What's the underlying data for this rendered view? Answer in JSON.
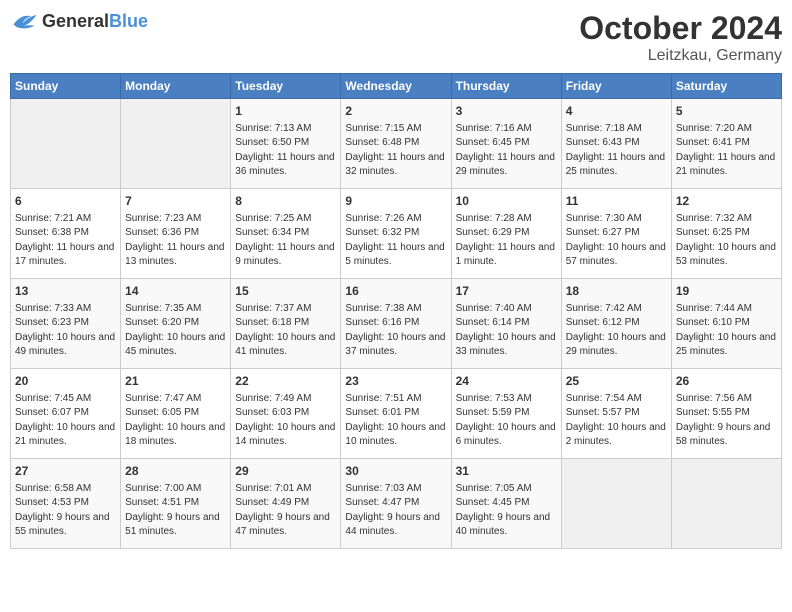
{
  "header": {
    "logo_general": "General",
    "logo_blue": "Blue",
    "month_year": "October 2024",
    "location": "Leitzkau, Germany"
  },
  "weekdays": [
    "Sunday",
    "Monday",
    "Tuesday",
    "Wednesday",
    "Thursday",
    "Friday",
    "Saturday"
  ],
  "weeks": [
    [
      {
        "day": "",
        "info": ""
      },
      {
        "day": "",
        "info": ""
      },
      {
        "day": "1",
        "info": "Sunrise: 7:13 AM\nSunset: 6:50 PM\nDaylight: 11 hours and 36 minutes."
      },
      {
        "day": "2",
        "info": "Sunrise: 7:15 AM\nSunset: 6:48 PM\nDaylight: 11 hours and 32 minutes."
      },
      {
        "day": "3",
        "info": "Sunrise: 7:16 AM\nSunset: 6:45 PM\nDaylight: 11 hours and 29 minutes."
      },
      {
        "day": "4",
        "info": "Sunrise: 7:18 AM\nSunset: 6:43 PM\nDaylight: 11 hours and 25 minutes."
      },
      {
        "day": "5",
        "info": "Sunrise: 7:20 AM\nSunset: 6:41 PM\nDaylight: 11 hours and 21 minutes."
      }
    ],
    [
      {
        "day": "6",
        "info": "Sunrise: 7:21 AM\nSunset: 6:38 PM\nDaylight: 11 hours and 17 minutes."
      },
      {
        "day": "7",
        "info": "Sunrise: 7:23 AM\nSunset: 6:36 PM\nDaylight: 11 hours and 13 minutes."
      },
      {
        "day": "8",
        "info": "Sunrise: 7:25 AM\nSunset: 6:34 PM\nDaylight: 11 hours and 9 minutes."
      },
      {
        "day": "9",
        "info": "Sunrise: 7:26 AM\nSunset: 6:32 PM\nDaylight: 11 hours and 5 minutes."
      },
      {
        "day": "10",
        "info": "Sunrise: 7:28 AM\nSunset: 6:29 PM\nDaylight: 11 hours and 1 minute."
      },
      {
        "day": "11",
        "info": "Sunrise: 7:30 AM\nSunset: 6:27 PM\nDaylight: 10 hours and 57 minutes."
      },
      {
        "day": "12",
        "info": "Sunrise: 7:32 AM\nSunset: 6:25 PM\nDaylight: 10 hours and 53 minutes."
      }
    ],
    [
      {
        "day": "13",
        "info": "Sunrise: 7:33 AM\nSunset: 6:23 PM\nDaylight: 10 hours and 49 minutes."
      },
      {
        "day": "14",
        "info": "Sunrise: 7:35 AM\nSunset: 6:20 PM\nDaylight: 10 hours and 45 minutes."
      },
      {
        "day": "15",
        "info": "Sunrise: 7:37 AM\nSunset: 6:18 PM\nDaylight: 10 hours and 41 minutes."
      },
      {
        "day": "16",
        "info": "Sunrise: 7:38 AM\nSunset: 6:16 PM\nDaylight: 10 hours and 37 minutes."
      },
      {
        "day": "17",
        "info": "Sunrise: 7:40 AM\nSunset: 6:14 PM\nDaylight: 10 hours and 33 minutes."
      },
      {
        "day": "18",
        "info": "Sunrise: 7:42 AM\nSunset: 6:12 PM\nDaylight: 10 hours and 29 minutes."
      },
      {
        "day": "19",
        "info": "Sunrise: 7:44 AM\nSunset: 6:10 PM\nDaylight: 10 hours and 25 minutes."
      }
    ],
    [
      {
        "day": "20",
        "info": "Sunrise: 7:45 AM\nSunset: 6:07 PM\nDaylight: 10 hours and 21 minutes."
      },
      {
        "day": "21",
        "info": "Sunrise: 7:47 AM\nSunset: 6:05 PM\nDaylight: 10 hours and 18 minutes."
      },
      {
        "day": "22",
        "info": "Sunrise: 7:49 AM\nSunset: 6:03 PM\nDaylight: 10 hours and 14 minutes."
      },
      {
        "day": "23",
        "info": "Sunrise: 7:51 AM\nSunset: 6:01 PM\nDaylight: 10 hours and 10 minutes."
      },
      {
        "day": "24",
        "info": "Sunrise: 7:53 AM\nSunset: 5:59 PM\nDaylight: 10 hours and 6 minutes."
      },
      {
        "day": "25",
        "info": "Sunrise: 7:54 AM\nSunset: 5:57 PM\nDaylight: 10 hours and 2 minutes."
      },
      {
        "day": "26",
        "info": "Sunrise: 7:56 AM\nSunset: 5:55 PM\nDaylight: 9 hours and 58 minutes."
      }
    ],
    [
      {
        "day": "27",
        "info": "Sunrise: 6:58 AM\nSunset: 4:53 PM\nDaylight: 9 hours and 55 minutes."
      },
      {
        "day": "28",
        "info": "Sunrise: 7:00 AM\nSunset: 4:51 PM\nDaylight: 9 hours and 51 minutes."
      },
      {
        "day": "29",
        "info": "Sunrise: 7:01 AM\nSunset: 4:49 PM\nDaylight: 9 hours and 47 minutes."
      },
      {
        "day": "30",
        "info": "Sunrise: 7:03 AM\nSunset: 4:47 PM\nDaylight: 9 hours and 44 minutes."
      },
      {
        "day": "31",
        "info": "Sunrise: 7:05 AM\nSunset: 4:45 PM\nDaylight: 9 hours and 40 minutes."
      },
      {
        "day": "",
        "info": ""
      },
      {
        "day": "",
        "info": ""
      }
    ]
  ]
}
